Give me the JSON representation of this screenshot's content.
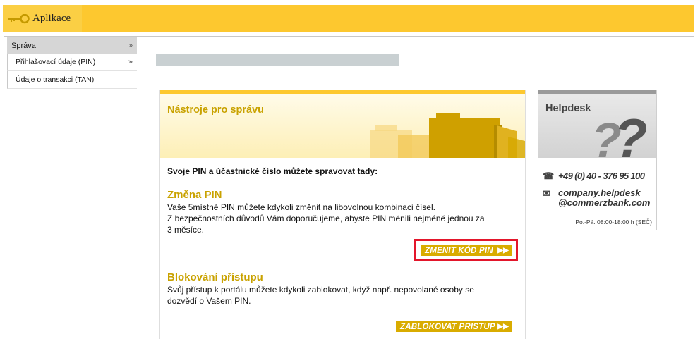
{
  "app": {
    "title": "Aplikace",
    "icon": "key-icon"
  },
  "sidebar": {
    "header": "Správa",
    "header_chevron": "»",
    "items": [
      {
        "label": "Přihlašovací údaje (PIN)",
        "arrow": "»"
      },
      {
        "label": "Údaje o transakci (TAN)",
        "arrow": ""
      }
    ]
  },
  "panel": {
    "title": "Nástroje pro správu",
    "intro": "Svoje PIN a účastnické číslo můžete spravovat tady:",
    "sections": [
      {
        "heading": "Změna PIN",
        "lines": [
          "Vaše 5místné PIN můžete kdykoli změnit na libovolnou kombinaci čísel.",
          "Z bezpečnostních důvodů Vám doporučujeme, abyste PIN měnili nejméně jednou za",
          "3 měsíce."
        ],
        "button": "ZMENIT KÓD PIN",
        "button_arrow": "▶▶"
      },
      {
        "heading": "Blokování přístupu",
        "lines": [
          "Svůj přístup k portálu můžete kdykoli zablokovat, když např. nepovolané osoby se",
          "dozvědí o Vašem PIN."
        ],
        "button": "ZABLOKOVAT PRISTUP",
        "button_arrow": "▶▶"
      }
    ]
  },
  "helpdesk": {
    "title": "Helpdesk",
    "phone": "+49 (0) 40 - 376 95 100",
    "email_line1": "company.helpdesk",
    "email_line2": "@commerzbank.com",
    "hours": "Po.-Pá. 08:00-18:00 h (SEČ)",
    "phone_icon": "☎",
    "email_icon": "✉"
  },
  "colors": {
    "accent": "#fdc82f",
    "gold": "#c9a200",
    "button": "#d9ac00",
    "highlight": "#e3162b"
  }
}
